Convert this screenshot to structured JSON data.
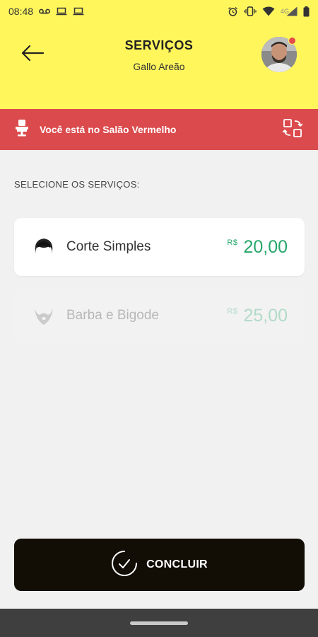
{
  "status_bar": {
    "time": "08:48",
    "network": "4G",
    "icons": [
      "voicemail-icon",
      "laptop-icon",
      "laptop-icon",
      "alarm-icon",
      "vibrate-icon",
      "wifi-icon",
      "signal-icon",
      "battery-icon"
    ]
  },
  "header": {
    "title": "SERVIÇOS",
    "subtitle": "Gallo Areão",
    "back_icon": "arrow-left-icon",
    "avatar_badge_color": "#e54a4a",
    "background": "#fff65c"
  },
  "salon_bar": {
    "text": "Você está no Salão Vermelho",
    "icon": "barber-chair-icon",
    "switch_icon": "swap-icon",
    "background": "#db4a4c"
  },
  "section_label": "SELECIONE OS SERVIÇOS:",
  "services": [
    {
      "name": "Corte Simples",
      "currency": "R$",
      "price": "20,00",
      "icon": "hair-icon",
      "enabled": true
    },
    {
      "name": "Barba e Bigode",
      "currency": "R$",
      "price": "25,00",
      "icon": "beard-icon",
      "enabled": false
    }
  ],
  "concluir_button": {
    "label": "CONCLUIR",
    "icon": "check-circle-icon",
    "background": "#120e06"
  },
  "colors": {
    "price_green": "#25a76b",
    "page_background": "#f1f1f1"
  }
}
